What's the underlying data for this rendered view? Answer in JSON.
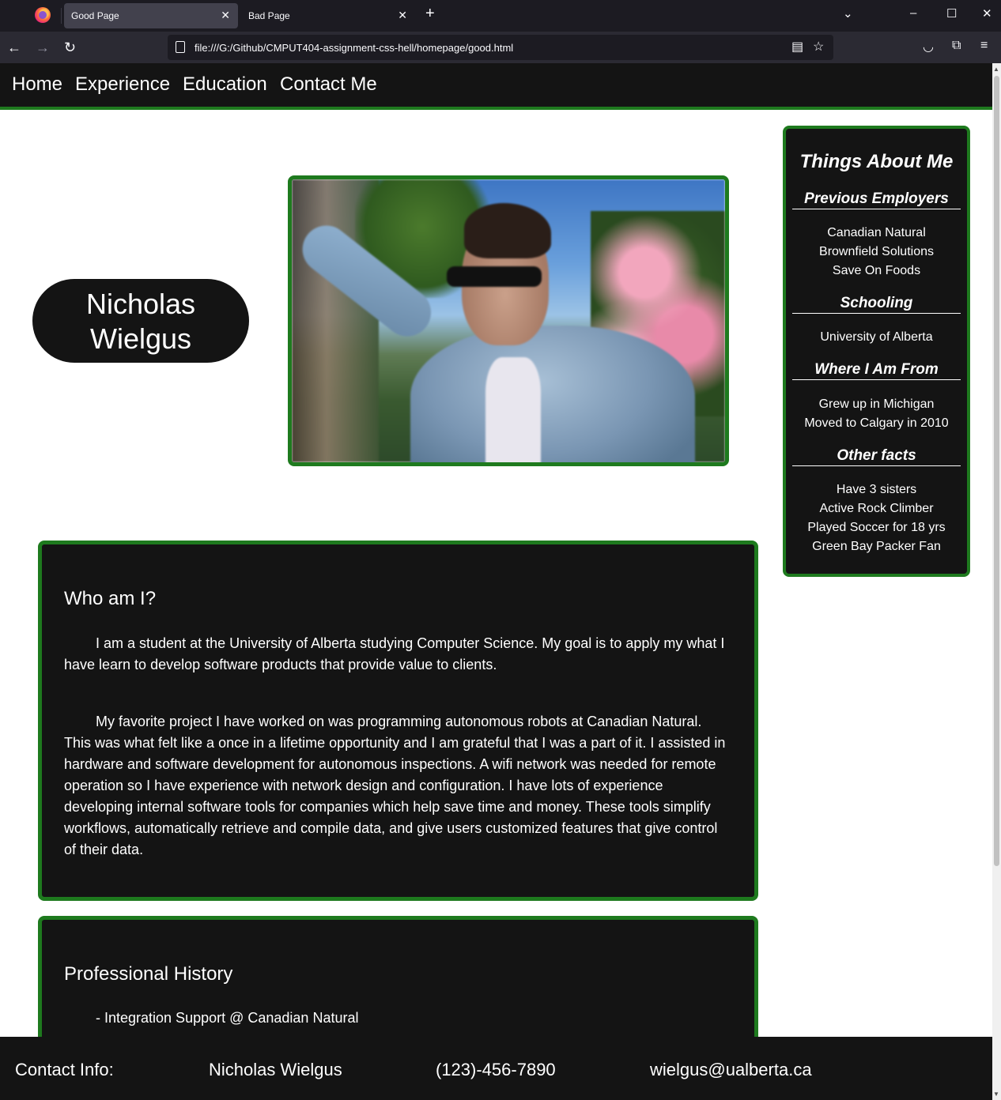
{
  "browser": {
    "tabs": [
      {
        "label": "Good Page",
        "active": true
      },
      {
        "label": "Bad Page",
        "active": false
      }
    ],
    "url": "file:///G:/Github/CMPUT404-assignment-css-hell/homepage/good.html"
  },
  "site": {
    "nav": [
      "Home",
      "Experience",
      "Education",
      "Contact Me"
    ],
    "name_line1": "Nicholas",
    "name_line2": "Wielgus",
    "about": {
      "title": "Things About Me",
      "sections": [
        {
          "heading": "Previous Employers",
          "items": [
            "Canadian Natural",
            "Brownfield Solutions",
            "Save On Foods"
          ]
        },
        {
          "heading": "Schooling",
          "items": [
            "University of Alberta"
          ]
        },
        {
          "heading": "Where I Am From",
          "items": [
            "Grew up in Michigan",
            "Moved to Calgary in 2010"
          ]
        },
        {
          "heading": "Other facts",
          "items": [
            "Have 3 sisters",
            "Active Rock Climber",
            "Played Soccer for 18 yrs",
            "Green Bay Packer Fan"
          ]
        }
      ]
    },
    "who": {
      "title": "Who am I?",
      "p1": "I am a student at the University of Alberta studying Computer Science. My goal is to apply my what I have learn to develop software products that provide value to clients.",
      "p2": "My favorite project I have worked on was programming autonomous robots at Canadian Natural. This was what felt like a once in a lifetime opportunity and I am grateful that I was a part of it. I assisted in hardware and software development for autonomous inspections. A wifi network was needed for remote operation so I have experience with network design and configuration. I have lots of experience developing internal software tools for companies which help save time and money. These tools simplify workflows, automatically retrieve and compile data, and give users customized features that give control of their data."
    },
    "professional": {
      "title": "Professional History",
      "items": [
        "- Integration Support @ Canadian Natural"
      ]
    },
    "footer": {
      "label": "Contact Info:",
      "name": "Nicholas Wielgus",
      "phone": "(123)-456-7890",
      "email": "wielgus@ualberta.ca"
    }
  },
  "colors": {
    "accent_green": "#1e7a1e",
    "panel_dark": "#141414"
  }
}
